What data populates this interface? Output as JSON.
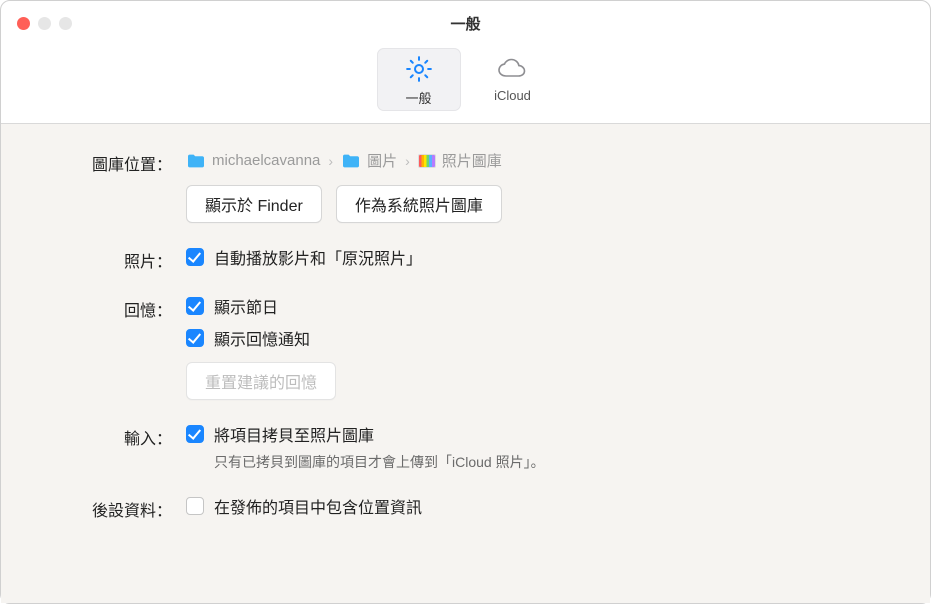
{
  "window": {
    "title": "一般"
  },
  "toolbar": {
    "tabs": [
      {
        "id": "general",
        "label": "一般",
        "selected": true
      },
      {
        "id": "icloud",
        "label": "iCloud",
        "selected": false
      }
    ]
  },
  "libraryLocation": {
    "label": "圖庫位置：",
    "breadcrumb": [
      {
        "kind": "folder",
        "label": "michaelcavanna"
      },
      {
        "kind": "folder",
        "label": "圖片"
      },
      {
        "kind": "photos",
        "label": "照片圖庫"
      }
    ],
    "buttons": {
      "showInFinder": "顯示於 Finder",
      "setSystemLibrary": "作為系統照片圖庫"
    }
  },
  "photos": {
    "label": "照片：",
    "autoplay": {
      "checked": true,
      "label": "自動播放影片和「原況照片」"
    }
  },
  "memories": {
    "label": "回憶：",
    "showHolidays": {
      "checked": true,
      "label": "顯示節日"
    },
    "showNotifications": {
      "checked": true,
      "label": "顯示回憶通知"
    },
    "resetBtn": {
      "label": "重置建議的回憶",
      "enabled": false
    }
  },
  "import": {
    "label": "輸入：",
    "copyToLibrary": {
      "checked": true,
      "label": "將項目拷貝至照片圖庫"
    },
    "help": "只有已拷貝到圖庫的項目才會上傳到「iCloud 照片」。"
  },
  "metadata": {
    "label": "後設資料：",
    "includeLocation": {
      "checked": false,
      "label": "在發佈的項目中包含位置資訊"
    }
  }
}
